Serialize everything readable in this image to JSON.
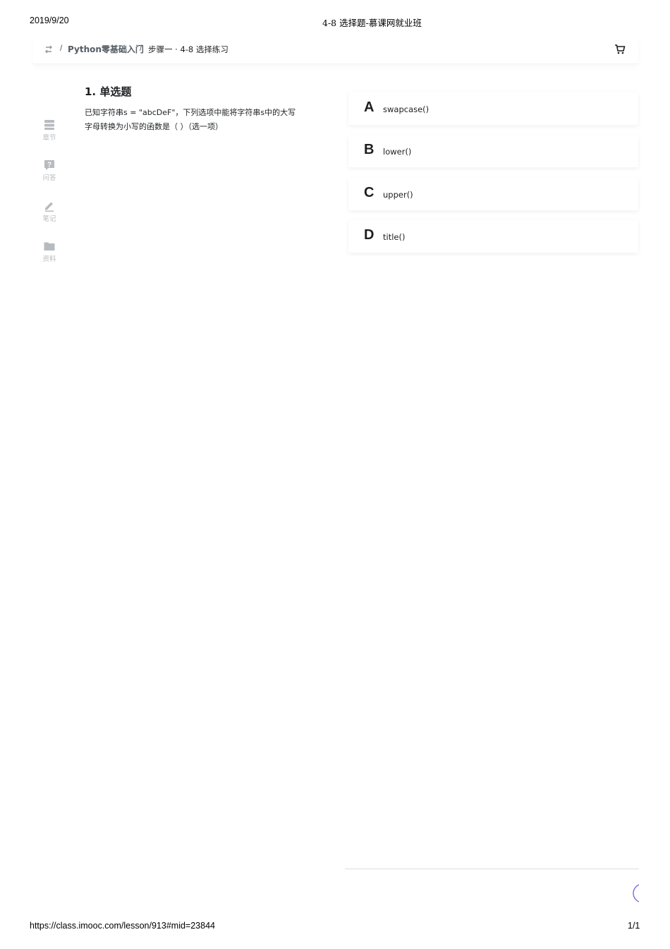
{
  "print_header": {
    "date": "2019/9/20",
    "title": "4-8 选择题-慕课网就业班"
  },
  "breadcrumb": {
    "sep": "/",
    "course": "Python零基础入门",
    "step": "步骤一 · 4-8 选择练习"
  },
  "sidebar": {
    "items": [
      {
        "label": "章节",
        "icon": "chapter-list-icon"
      },
      {
        "label": "问答",
        "icon": "question-icon"
      },
      {
        "label": "笔记",
        "icon": "pencil-icon"
      },
      {
        "label": "资料",
        "icon": "folder-icon"
      }
    ]
  },
  "question": {
    "title": "1. 单选题",
    "text": "已知字符串s = \"abcDeF\"，下列选项中能将字符串s中的大写字母转换为小写的函数是（ ）（选一项）"
  },
  "options": [
    {
      "letter": "A",
      "text": "swapcase()"
    },
    {
      "letter": "B",
      "text": "lower()"
    },
    {
      "letter": "C",
      "text": "upper()"
    },
    {
      "letter": "D",
      "text": "title()"
    }
  ],
  "print_footer": {
    "url": "https://class.imooc.com/lesson/913#mid=23844",
    "page": "1/1"
  },
  "colors": {
    "accent": "#7b5cd6",
    "muted_icon": "#b7bbbf",
    "text": "#1c1f21"
  }
}
